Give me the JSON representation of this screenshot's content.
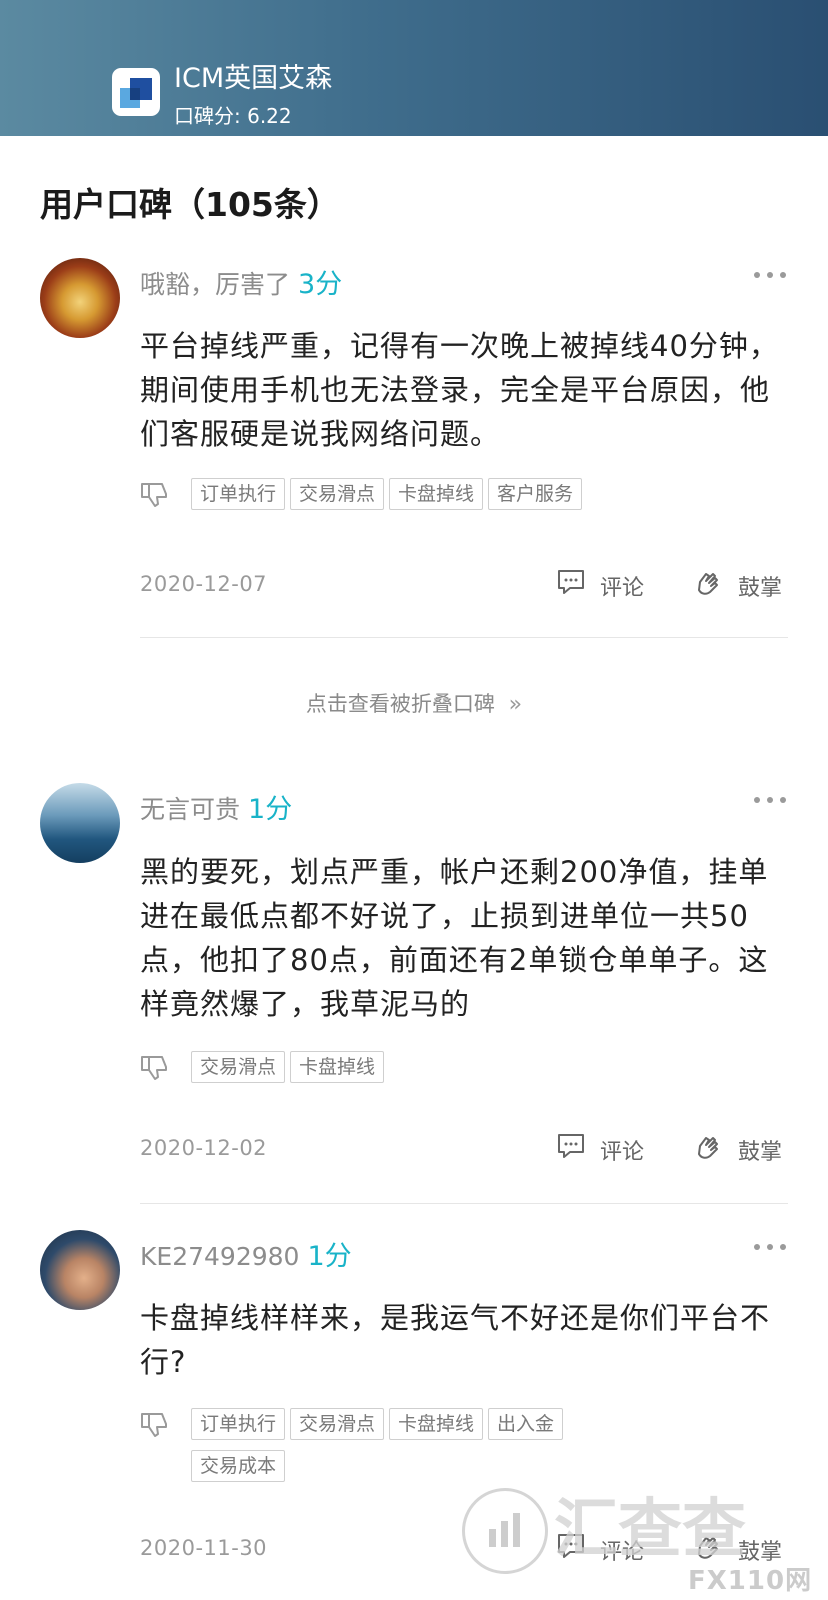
{
  "broker": {
    "name": "ICM英国艾森",
    "score_label": "口碑分: 6.22"
  },
  "section": {
    "title": "用户口碑（105条）"
  },
  "reviews": [
    {
      "user": "哦豁，厉害了",
      "rating": "3分",
      "text": "平台掉线严重，记得有一次晚上被掉线40分钟，期间使用手机也无法登录，完全是平台原因，他们客服硬是说我网络问题。",
      "tags": [
        "订单执行",
        "交易滑点",
        "卡盘掉线",
        "客户服务"
      ],
      "date": "2020-12-07",
      "comment_label": "评论",
      "applaud_label": "鼓掌"
    },
    {
      "user": "无言可贵",
      "rating": "1分",
      "text": "黑的要死，划点严重，帐户还剩200净值，挂单进在最低点都不好说了，止损到进单位一共50点，他扣了80点，前面还有2单锁仓单单子。这样竟然爆了，我草泥马的",
      "tags": [
        "交易滑点",
        "卡盘掉线"
      ],
      "date": "2020-12-02",
      "comment_label": "评论",
      "applaud_label": "鼓掌"
    },
    {
      "user": "KE27492980",
      "rating": "1分",
      "text": "卡盘掉线样样来，是我运气不好还是你们平台不行?",
      "tags": [
        "订单执行",
        "交易滑点",
        "卡盘掉线",
        "出入金",
        "交易成本"
      ],
      "date": "2020-11-30",
      "comment_label": "评论",
      "applaud_label": "鼓掌"
    }
  ],
  "fold_link": "点击查看被折叠口碑",
  "watermark": {
    "brand": "汇查查",
    "sub": "FX110网"
  },
  "colors": {
    "accent": "#19b3c8",
    "header_start": "#5b8aa1",
    "header_end": "#2a4f72"
  }
}
